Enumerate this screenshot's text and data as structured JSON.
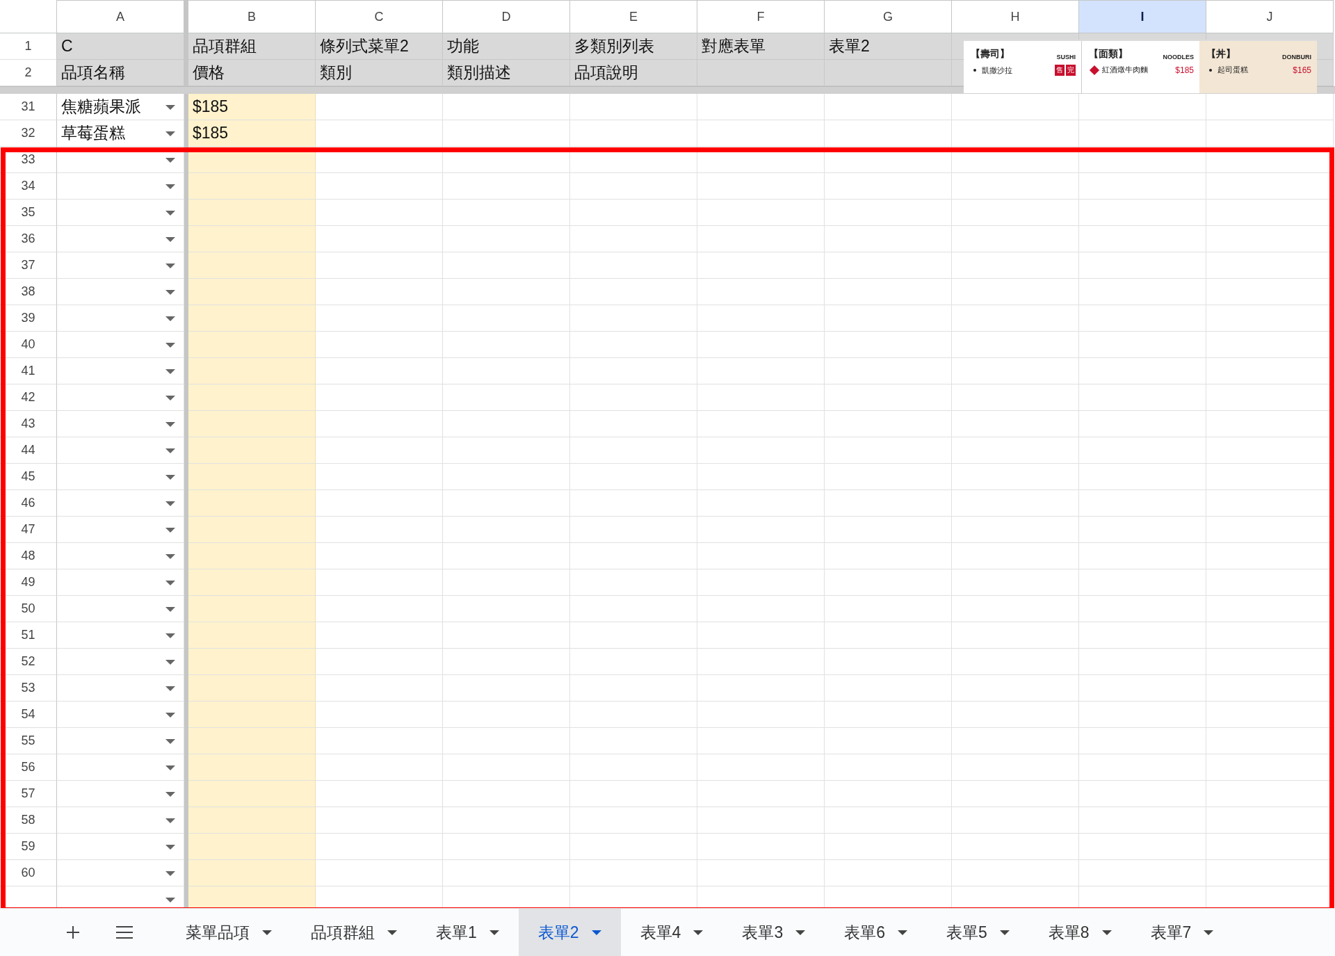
{
  "columns": [
    {
      "label": "A",
      "kind": "dropdown",
      "selected": false
    },
    {
      "label": "B",
      "kind": "highlighted",
      "selected": false
    },
    {
      "label": "C",
      "kind": "plain",
      "selected": false
    },
    {
      "label": "D",
      "kind": "plain",
      "selected": false
    },
    {
      "label": "E",
      "kind": "plain",
      "selected": false
    },
    {
      "label": "F",
      "kind": "plain",
      "selected": false
    },
    {
      "label": "G",
      "kind": "plain",
      "selected": false
    },
    {
      "label": "H",
      "kind": "plain",
      "selected": false
    },
    {
      "label": "I",
      "kind": "plain",
      "selected": true
    },
    {
      "label": "J",
      "kind": "plain",
      "selected": false
    }
  ],
  "frozen_rows": [
    {
      "number": "1",
      "cells": [
        "C",
        "品項群組",
        "條列式菜單2",
        "功能",
        "多類別列表",
        "對應表單",
        "表單2"
      ]
    },
    {
      "number": "2",
      "cells": [
        "品項名稱",
        "價格",
        "類別",
        "類別描述",
        "品項說明"
      ]
    }
  ],
  "rows": [
    {
      "number": "31",
      "cells": [
        "焦糖蘋果派",
        "$185"
      ]
    },
    {
      "number": "32",
      "cells": [
        "草莓蛋糕",
        "$185"
      ]
    },
    {
      "number": "33"
    },
    {
      "number": "34"
    },
    {
      "number": "35"
    },
    {
      "number": "36"
    },
    {
      "number": "37"
    },
    {
      "number": "38"
    },
    {
      "number": "39"
    },
    {
      "number": "40"
    },
    {
      "number": "41"
    },
    {
      "number": "42"
    },
    {
      "number": "43"
    },
    {
      "number": "44"
    },
    {
      "number": "45"
    },
    {
      "number": "46"
    },
    {
      "number": "47"
    },
    {
      "number": "48"
    },
    {
      "number": "49"
    },
    {
      "number": "50"
    },
    {
      "number": "51"
    },
    {
      "number": "52"
    },
    {
      "number": "53"
    },
    {
      "number": "54"
    },
    {
      "number": "55"
    },
    {
      "number": "56"
    },
    {
      "number": "57"
    },
    {
      "number": "58"
    },
    {
      "number": "59"
    },
    {
      "number": "60"
    }
  ],
  "menu_image": {
    "sections": [
      {
        "title": "【壽司】",
        "subtitle": "SUSHI",
        "kind": "plain",
        "items": [
          {
            "name": "凱撒沙拉",
            "sold_out": [
              "售",
              "完"
            ]
          }
        ]
      },
      {
        "title": "【面類】",
        "subtitle": "NOODLES",
        "kind": "plain",
        "items": [
          {
            "name": "紅酒燉牛肉麵",
            "price": "$185",
            "tag": true
          }
        ]
      },
      {
        "title": "【丼】",
        "subtitle": "DONBURI",
        "kind": "featured",
        "items": [
          {
            "name": "起司蛋糕",
            "price": "$165"
          }
        ]
      }
    ]
  },
  "sheet_tabs": [
    {
      "label": "菜單品項",
      "selected": false
    },
    {
      "label": "品項群組",
      "selected": false
    },
    {
      "label": "表單1",
      "selected": false
    },
    {
      "label": "表單2",
      "selected": true
    },
    {
      "label": "表單4",
      "selected": false
    },
    {
      "label": "表單3",
      "selected": false
    },
    {
      "label": "表單6",
      "selected": false
    },
    {
      "label": "表單5",
      "selected": false
    },
    {
      "label": "表單8",
      "selected": false
    },
    {
      "label": "表單7",
      "selected": false
    }
  ]
}
